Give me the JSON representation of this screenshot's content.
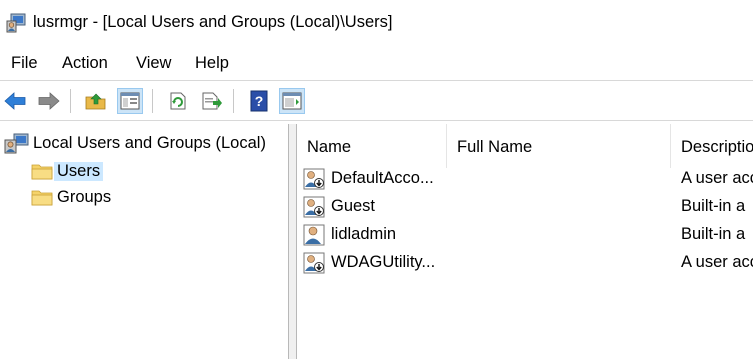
{
  "window": {
    "title": "lusrmgr - [Local Users and Groups (Local)\\Users]"
  },
  "menu": [
    "File",
    "Action",
    "View",
    "Help"
  ],
  "toolbar": {
    "buttons": [
      "back-icon",
      "forward-icon",
      "up-folder-icon",
      "show-hide-console-tree-icon",
      "refresh-icon",
      "export-list-icon",
      "help-icon",
      "show-hide-action-pane-icon"
    ]
  },
  "tree": {
    "root": "Local Users and Groups (Local)",
    "items": [
      "Users",
      "Groups"
    ],
    "selected": "Users"
  },
  "list": {
    "columns": [
      "Name",
      "Full Name",
      "Description"
    ],
    "rows": [
      {
        "name": "DefaultAcco...",
        "full_name": "",
        "description": "A user acc"
      },
      {
        "name": "Guest",
        "full_name": "",
        "description": "Built-in a"
      },
      {
        "name": "lidladmin",
        "full_name": "",
        "description": "Built-in a"
      },
      {
        "name": "WDAGUtility...",
        "full_name": "",
        "description": "A user acc"
      }
    ]
  },
  "colors": {
    "selection": "#cce8ff",
    "toolbar_active": "#cce4f7",
    "folder": "#f5d36a",
    "arrow_blue": "#2e7fd8"
  }
}
